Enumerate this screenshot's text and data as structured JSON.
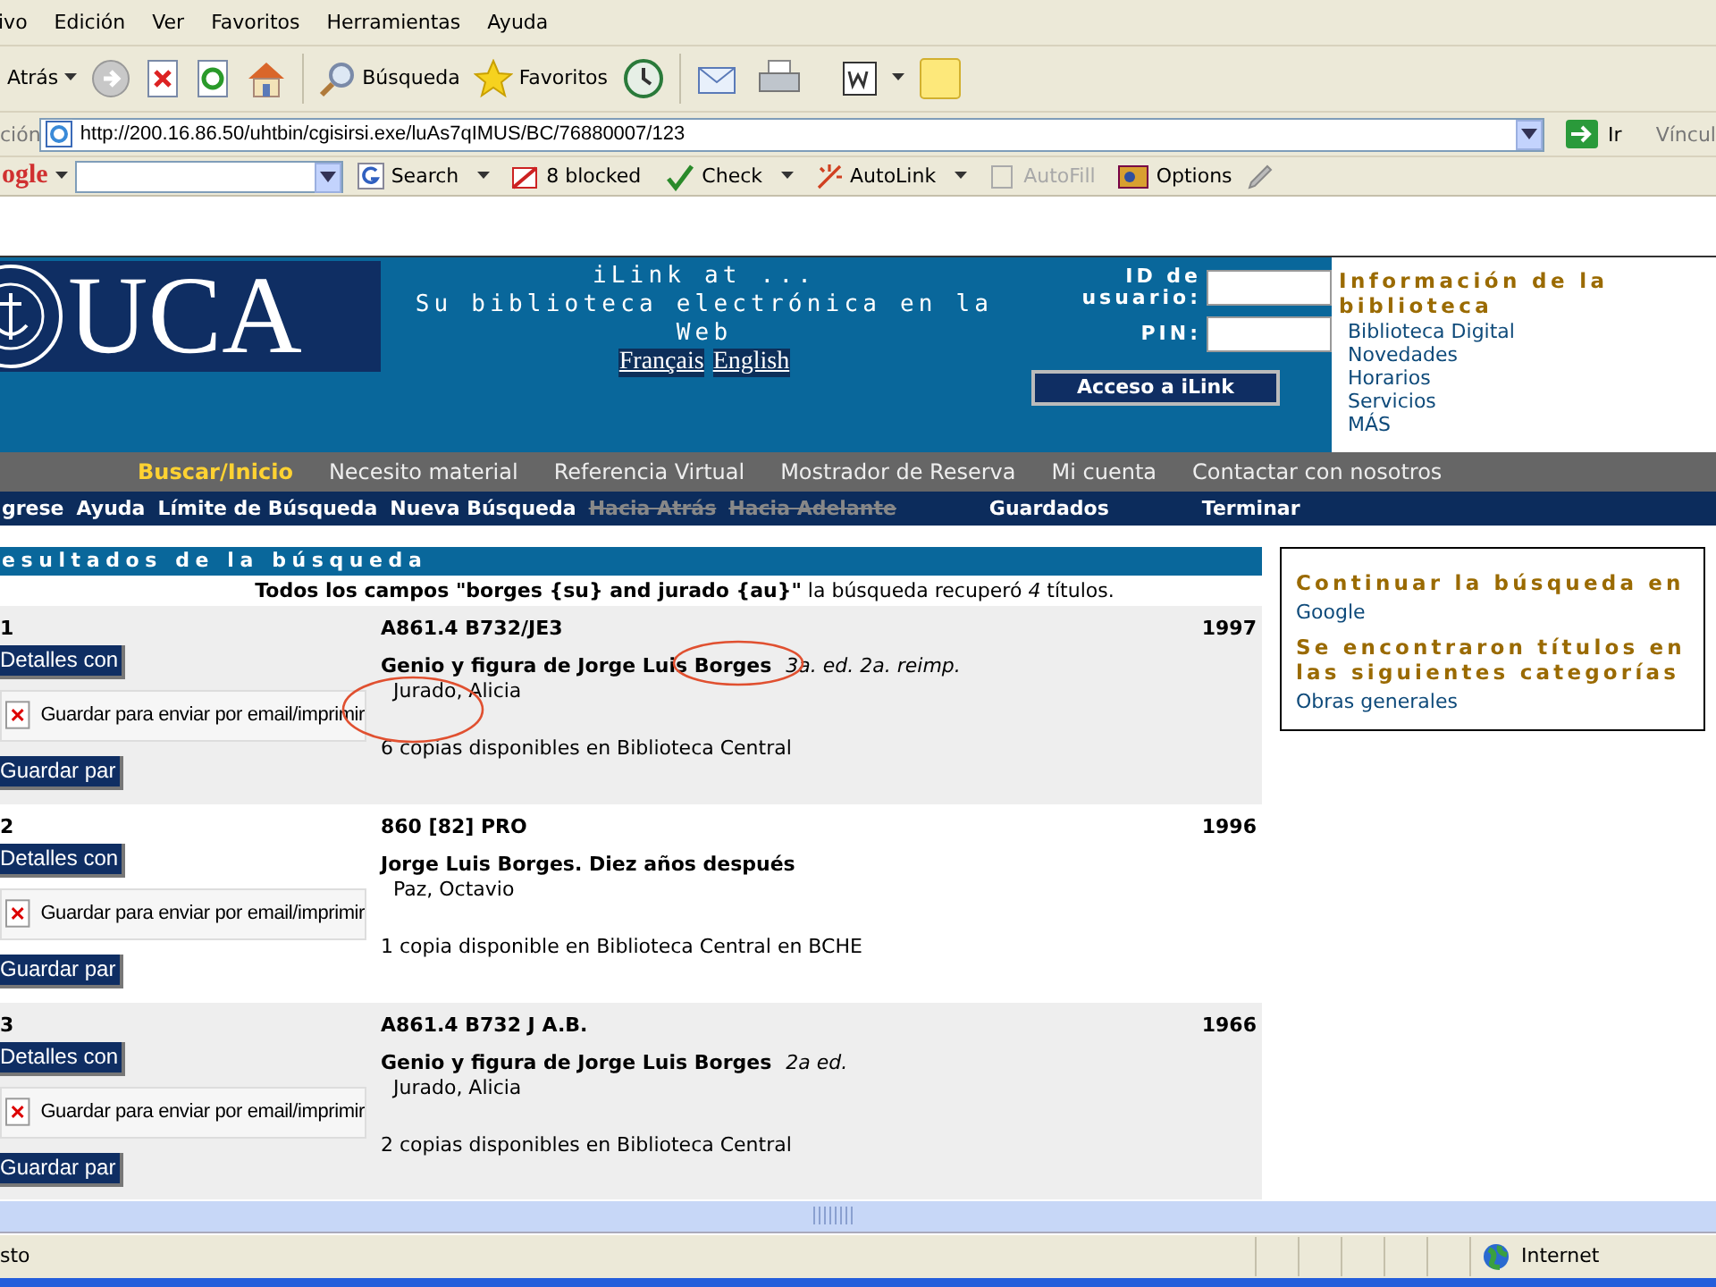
{
  "menu_bar": [
    "ivo",
    "Edición",
    "Ver",
    "Favoritos",
    "Herramientas",
    "Ayuda"
  ],
  "toolbar": {
    "back_label": "Atrás",
    "search_label": "Búsqueda",
    "favorites_label": "Favoritos"
  },
  "address_bar": {
    "label": "ción",
    "url": "http://200.16.86.50/uhtbin/cgisirsi.exe/luAs7qIMUS/BC/76880007/123",
    "go_label": "Ir",
    "links_label": "Víncul"
  },
  "google_toolbar": {
    "logo": "ogle",
    "items": [
      {
        "kind": "search",
        "label": "Search",
        "disabled": false
      },
      {
        "kind": "blocked",
        "label": "8 blocked",
        "disabled": false
      },
      {
        "kind": "check",
        "label": "Check",
        "disabled": false
      },
      {
        "kind": "autolink",
        "label": "AutoLink",
        "disabled": false
      },
      {
        "kind": "autofill",
        "label": "AutoFill",
        "disabled": true
      },
      {
        "kind": "options",
        "label": "Options",
        "disabled": false
      }
    ]
  },
  "header": {
    "logo": "UCA",
    "title_lines": [
      "iLink at ...",
      "Su biblioteca electrónica en la",
      "Web"
    ],
    "languages": [
      "Français",
      "English"
    ],
    "login": {
      "user_label": "ID de usuario:",
      "pin_label": "PIN:",
      "button": "Acceso a iLink"
    },
    "info": {
      "title": "Información de la biblioteca",
      "links": [
        "Biblioteca Digital",
        "Novedades",
        "Horarios",
        "Servicios",
        "MÁS"
      ]
    }
  },
  "nav_primary": [
    {
      "label": "Buscar/Inicio",
      "selected": true
    },
    {
      "label": "Necesito material",
      "selected": false
    },
    {
      "label": "Referencia Virtual",
      "selected": false
    },
    {
      "label": "Mostrador de Reserva",
      "selected": false
    },
    {
      "label": "Mi cuenta",
      "selected": false
    },
    {
      "label": "Contactar con nosotros",
      "selected": false
    }
  ],
  "nav_secondary": [
    {
      "label": "grese",
      "disabled": false
    },
    {
      "label": "Ayuda",
      "disabled": false
    },
    {
      "label": "Límite de Búsqueda",
      "disabled": false
    },
    {
      "label": "Nueva Búsqueda",
      "disabled": false
    },
    {
      "label": "Hacia Atrás",
      "disabled": true
    },
    {
      "label": "Hacia Adelante",
      "disabled": true
    },
    {
      "label": "Guardados",
      "disabled": false
    },
    {
      "label": "Terminar",
      "disabled": false
    }
  ],
  "results": {
    "title": "esultados de la búsqueda",
    "summary": "**Todos los campos \"borges {su} and jurado {au}\"** la búsqueda recuperó *4* títulos.",
    "items": [
      {
        "number": "1",
        "call_number": "A861.4 B732/JE3",
        "year": "1997",
        "title": "Genio y figura de Jorge Luis Borges",
        "edition": "3a. ed. 2a. reimp.",
        "author": "Jurado, Alicia",
        "availability": "6 copias disponibles en Biblioteca Central",
        "details_button": "Detalles con",
        "save_label": "Guardar para enviar por email/imprimir",
        "save_button": "Guardar par",
        "circled": true
      },
      {
        "number": "2",
        "call_number": "860 [82] PRO",
        "year": "1996",
        "title": "Jorge Luis Borges. Diez años después",
        "author": "Paz, Octavio",
        "availability": "1 copia disponible en Biblioteca Central en BCHE",
        "details_button": "Detalles con",
        "save_label": "Guardar para enviar por email/imprimir",
        "save_button": "Guardar par",
        "circled": false
      },
      {
        "number": "3",
        "call_number": "A861.4 B732 J A.B.",
        "year": "1966",
        "title": "Genio y figura de Jorge Luis Borges",
        "edition": "2a ed.",
        "author": "Jurado, Alicia",
        "availability": "2 copias disponibles en Biblioteca Central",
        "details_button": "Detalles con",
        "save_label": "Guardar para enviar por email/imprimir",
        "save_button": "Guardar par",
        "circled": false
      }
    ]
  },
  "sidebar": {
    "continue_heading": "Continuar la búsqueda en",
    "continue_link": "Google",
    "categories_heading": "Se encontraron títulos en las siguientes categorías",
    "category_link": "Obras generales"
  },
  "status_bar": {
    "text": "sto",
    "zone": "Internet"
  }
}
